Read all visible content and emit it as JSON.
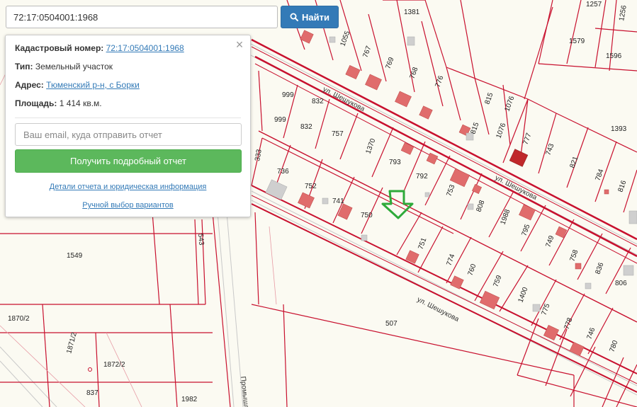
{
  "search": {
    "value": "72:17:0504001:1968",
    "button_label": "Найти"
  },
  "panel": {
    "close_symbol": "×",
    "cadastral_label": "Кадастровый номер:",
    "cadastral_value": "72:17:0504001:1968",
    "type_label": "Тип:",
    "type_value": "Земельный участок",
    "address_label": "Адрес:",
    "address_value": "Тюменский р-н, с Борки",
    "area_label": "Площадь:",
    "area_value": "1 414 кв.м.",
    "email_placeholder": "Ваш email, куда отправить отчет",
    "report_button": "Получить подробный отчет",
    "details_link": "Детали отчета и юридическая информация",
    "manual_link": "Ручной выбор вариантов"
  },
  "map": {
    "streets": [
      {
        "text": "ул. Шешукова"
      },
      {
        "text": "ул. Шешукова"
      },
      {
        "text": "ул. Шешукова"
      },
      {
        "text": "Промышл"
      }
    ],
    "parcels": [
      {
        "text": "1381"
      },
      {
        "text": "1257"
      },
      {
        "text": "1256"
      },
      {
        "text": "1579"
      },
      {
        "text": "1596"
      },
      {
        "text": "1055"
      },
      {
        "text": "767"
      },
      {
        "text": "769"
      },
      {
        "text": "768"
      },
      {
        "text": "776"
      },
      {
        "text": "815"
      },
      {
        "text": "1076"
      },
      {
        "text": "999"
      },
      {
        "text": "832"
      },
      {
        "text": "999"
      },
      {
        "text": "832"
      },
      {
        "text": "757"
      },
      {
        "text": "1370"
      },
      {
        "text": "815"
      },
      {
        "text": "1076"
      },
      {
        "text": "777"
      },
      {
        "text": "743"
      },
      {
        "text": "821"
      },
      {
        "text": "1393"
      },
      {
        "text": "793"
      },
      {
        "text": "792"
      },
      {
        "text": "736"
      },
      {
        "text": "752"
      },
      {
        "text": "741"
      },
      {
        "text": "750"
      },
      {
        "text": "753"
      },
      {
        "text": "808"
      },
      {
        "text": "1988"
      },
      {
        "text": "795"
      },
      {
        "text": "749"
      },
      {
        "text": "784"
      },
      {
        "text": "816"
      },
      {
        "text": "333"
      },
      {
        "text": "751"
      },
      {
        "text": "774"
      },
      {
        "text": "760"
      },
      {
        "text": "759"
      },
      {
        "text": "1400"
      },
      {
        "text": "775"
      },
      {
        "text": "758"
      },
      {
        "text": "836"
      },
      {
        "text": "806"
      },
      {
        "text": "1549"
      },
      {
        "text": "543"
      },
      {
        "text": "507"
      },
      {
        "text": "778"
      },
      {
        "text": "746"
      },
      {
        "text": "780"
      },
      {
        "text": "1870/2"
      },
      {
        "text": "1871/2"
      },
      {
        "text": "1872/2"
      },
      {
        "text": "837"
      },
      {
        "text": "1982"
      }
    ]
  },
  "colors": {
    "parcel_border": "#c8102e",
    "building": "#e06c6c",
    "selected_building": "#c0282b",
    "marker": "#2eaa3a"
  }
}
